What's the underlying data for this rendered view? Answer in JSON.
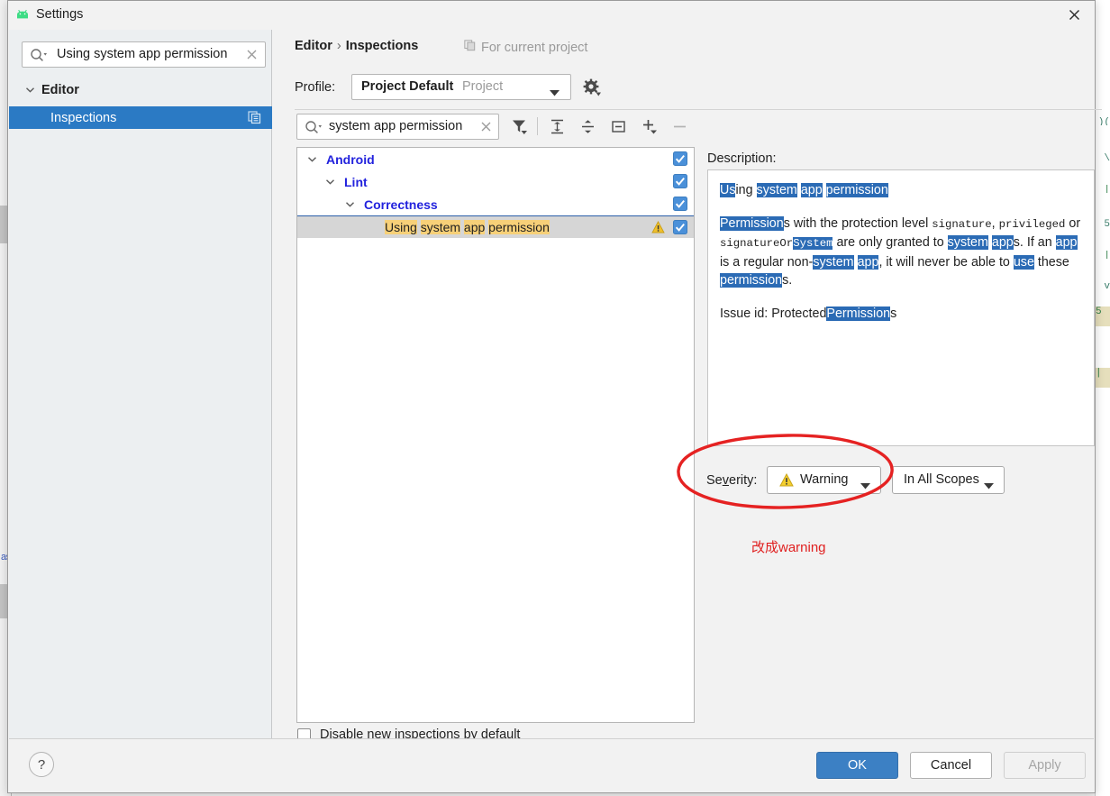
{
  "window": {
    "title": "Settings",
    "app_icon": "android-icon",
    "close_icon": "close-icon"
  },
  "sidebar": {
    "search": {
      "value": "Using system app permission",
      "placeholder": "Search settings",
      "search_icon": "search-icon",
      "clear_icon": "clear-icon"
    },
    "items": [
      {
        "label": "Editor",
        "level": 0,
        "expanded": true,
        "selected": false
      },
      {
        "label": "Inspections",
        "level": 1,
        "expanded": false,
        "selected": true,
        "trailing_icon": "copy-icon"
      }
    ]
  },
  "content": {
    "breadcrumb": {
      "root": "Editor",
      "separator": "›",
      "leaf": "Inspections"
    },
    "scope_note": {
      "label": "For current project",
      "icon": "copy-icon"
    },
    "profile": {
      "label": "Profile:",
      "name": "Project Default",
      "scope": "Project",
      "arrow_icon": "chevron-down-icon",
      "gear_icon": "gear-icon"
    },
    "inspection_search": {
      "value": "system app permission",
      "placeholder": "Search inspections",
      "search_icon": "search-icon",
      "clear_icon": "clear-icon"
    },
    "toolbar": [
      {
        "name": "filter-button",
        "icon": "filter-icon",
        "enabled": true
      },
      {
        "name": "expand-all-button",
        "icon": "expand-all-icon",
        "enabled": true
      },
      {
        "name": "collapse-all-button",
        "icon": "collapse-all-icon",
        "enabled": true
      },
      {
        "name": "reset-to-empty-button",
        "icon": "box-minus-icon",
        "enabled": true
      },
      {
        "name": "add-button",
        "icon": "plus-icon",
        "enabled": true
      },
      {
        "name": "remove-button",
        "icon": "minus-icon",
        "enabled": false
      }
    ]
  },
  "tree": {
    "nodes": [
      {
        "label": "Android",
        "depth": 0,
        "expanded": true,
        "checked": true,
        "selected": false
      },
      {
        "label": "Lint",
        "depth": 1,
        "expanded": true,
        "checked": true,
        "selected": false
      },
      {
        "label": "Correctness",
        "depth": 2,
        "expanded": true,
        "checked": true,
        "selected": false
      }
    ],
    "selected_leaf": {
      "depth": 3,
      "checked": true,
      "selected": true,
      "severity_icon": "warning-icon",
      "segments": [
        {
          "text": "Using",
          "highlight": true
        },
        {
          "text": " ",
          "highlight": false
        },
        {
          "text": "system",
          "highlight": true
        },
        {
          "text": " ",
          "highlight": false
        },
        {
          "text": "app",
          "highlight": true
        },
        {
          "text": " ",
          "highlight": false
        },
        {
          "text": "permission",
          "highlight": true
        }
      ]
    },
    "disable_new": {
      "label": "Disable new inspections by default",
      "checked": false
    }
  },
  "description": {
    "label": "Description:",
    "paragraphs": [
      [
        {
          "text": "Us",
          "style": "sel"
        },
        {
          "text": "ing ",
          "style": "plain"
        },
        {
          "text": "system",
          "style": "sel"
        },
        {
          "text": " ",
          "style": "plain"
        },
        {
          "text": "app",
          "style": "sel"
        },
        {
          "text": " ",
          "style": "plain"
        },
        {
          "text": "permission",
          "style": "sel"
        }
      ],
      [
        {
          "text": "Permission",
          "style": "sel"
        },
        {
          "text": "s with the protection level ",
          "style": "plain"
        },
        {
          "text": "signature",
          "style": "code"
        },
        {
          "text": ", ",
          "style": "plain"
        },
        {
          "text": "privileged",
          "style": "code"
        },
        {
          "text": " or ",
          "style": "plain"
        },
        {
          "text": "signatureOr",
          "style": "code"
        },
        {
          "text": "System",
          "style": "code-sel"
        },
        {
          "text": " are only granted to ",
          "style": "plain"
        },
        {
          "text": "system",
          "style": "sel"
        },
        {
          "text": " ",
          "style": "plain"
        },
        {
          "text": "app",
          "style": "sel"
        },
        {
          "text": "s. If an ",
          "style": "plain"
        },
        {
          "text": "app",
          "style": "sel"
        },
        {
          "text": " is a regular non-",
          "style": "plain"
        },
        {
          "text": "system",
          "style": "sel"
        },
        {
          "text": " ",
          "style": "plain"
        },
        {
          "text": "app",
          "style": "sel"
        },
        {
          "text": ", it will never be able to ",
          "style": "plain"
        },
        {
          "text": "use",
          "style": "sel"
        },
        {
          "text": " these ",
          "style": "plain"
        },
        {
          "text": "permission",
          "style": "sel"
        },
        {
          "text": "s.",
          "style": "plain"
        }
      ],
      [
        {
          "text": "Issue id: Protected",
          "style": "plain"
        },
        {
          "text": "Permission",
          "style": "sel"
        },
        {
          "text": "s",
          "style": "plain"
        }
      ]
    ]
  },
  "severity": {
    "label_prefix": "Se",
    "label_mnemonic": "v",
    "label_suffix": "erity:",
    "value": "Warning",
    "icon": "warning-icon",
    "arrow_icon": "chevron-down-icon"
  },
  "scope": {
    "value": "In All Scopes",
    "arrow_icon": "chevron-down-icon"
  },
  "annotation": {
    "text": "改成warning",
    "color": "#e02020",
    "shape": "hand-drawn-ellipse"
  },
  "footer": {
    "help": "?",
    "ok": "OK",
    "cancel": "Cancel",
    "apply": "Apply",
    "apply_enabled": false
  },
  "colors": {
    "accent": "#2b7ac4",
    "selection": "#2b6bb5",
    "search_highlight": "#f7d078",
    "tree_node": "#2222dd",
    "annotation_red": "#e02020",
    "warning_yellow": "#e8c22a",
    "android_green": "#3ddc84"
  }
}
